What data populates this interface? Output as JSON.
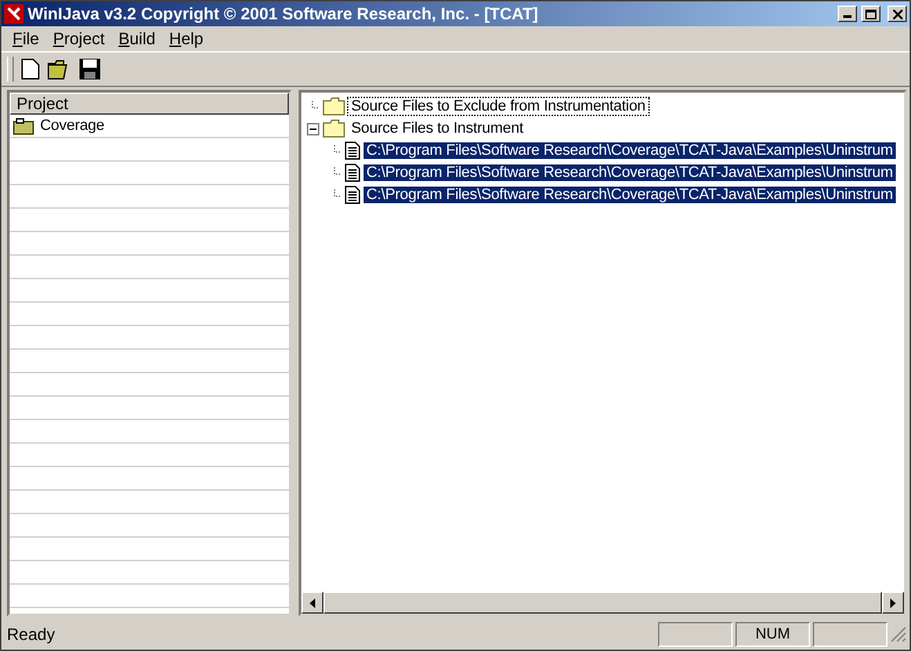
{
  "window": {
    "title": "WinIJava v3.2 Copyright © 2001 Software Research, Inc. - [TCAT]"
  },
  "menu": [
    {
      "label": "File"
    },
    {
      "label": "Project"
    },
    {
      "label": "Build"
    },
    {
      "label": "Help"
    }
  ],
  "project_pane": {
    "header": "Project",
    "items": [
      {
        "label": "Coverage",
        "selected": false
      }
    ]
  },
  "tree": [
    {
      "label": "Source Files to Exclude from Instrumentation",
      "kind": "folder",
      "selected": false,
      "focused": true
    },
    {
      "label": "Source Files to Instrument",
      "kind": "folder",
      "selected": false,
      "focused": false,
      "expanded": true,
      "children": [
        {
          "label": "C:\\Program Files\\Software Research\\Coverage\\TCAT-Java\\Examples\\Uninstrum",
          "kind": "file",
          "selected": true,
          "focused": false
        },
        {
          "label": "C:\\Program Files\\Software Research\\Coverage\\TCAT-Java\\Examples\\Uninstrum",
          "kind": "file",
          "selected": true,
          "focused": false
        },
        {
          "label": "C:\\Program Files\\Software Research\\Coverage\\TCAT-Java\\Examples\\Uninstrum",
          "kind": "file",
          "selected": true,
          "focused": false
        }
      ]
    }
  ],
  "status_bar": {
    "message": "Ready",
    "indicators": [
      {
        "kind": "blank"
      },
      {
        "kind": "text",
        "text": "NUM"
      },
      {
        "kind": "blank"
      }
    ]
  }
}
